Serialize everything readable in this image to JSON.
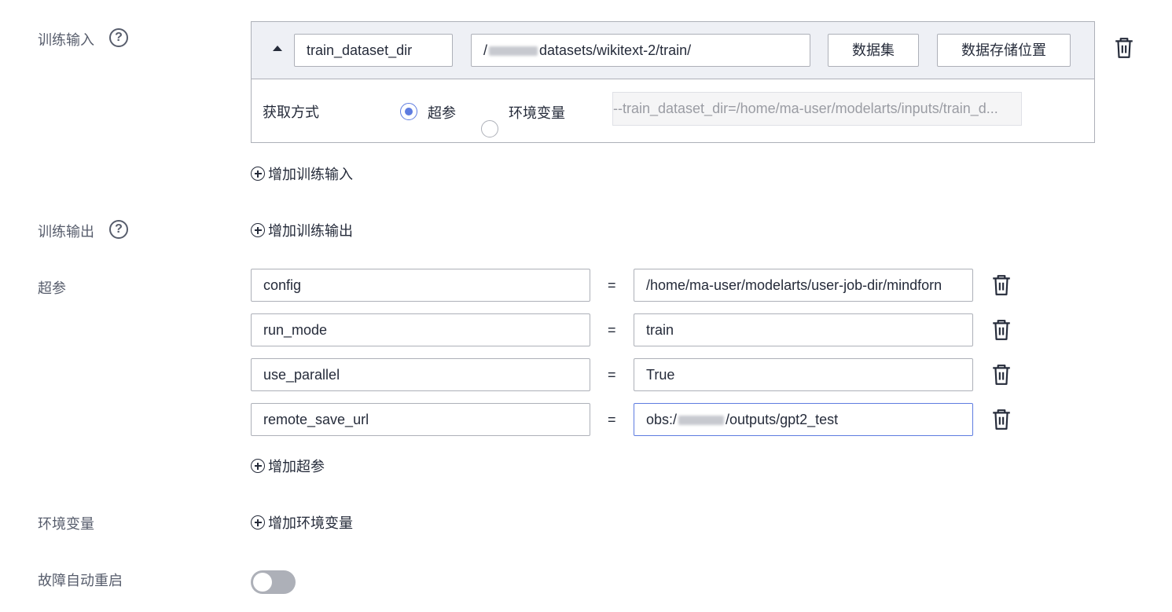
{
  "training_input": {
    "label": "训练输入",
    "help_icon": "question-circle-icon",
    "name_value": "train_dataset_dir",
    "path_prefix": "/",
    "path_suffix": "datasets/wikitext-2/train/",
    "dataset_button": "数据集",
    "storage_button": "数据存储位置",
    "acquire_label": "获取方式",
    "option_hyperparam": "超参",
    "option_env": "环境变量",
    "selected_option": "超参",
    "preview": "--train_dataset_dir=/home/ma-user/modelarts/inputs/train_d...",
    "add_label": "增加训练输入"
  },
  "training_output": {
    "label": "训练输出",
    "help_icon": "question-circle-icon",
    "add_label": "增加训练输出"
  },
  "hyperparams": {
    "label": "超参",
    "equals": "=",
    "rows": [
      {
        "key": "config",
        "value": "/home/ma-user/modelarts/user-job-dir/mindforn"
      },
      {
        "key": "run_mode",
        "value": "train"
      },
      {
        "key": "use_parallel",
        "value": "True"
      },
      {
        "key": "remote_save_url",
        "value_prefix": "obs:/",
        "value_suffix": "/outputs/gpt2_test"
      }
    ],
    "add_label": "增加超参"
  },
  "env_vars": {
    "label": "环境变量",
    "add_label": "增加环境变量"
  },
  "auto_restart": {
    "label": "故障自动重启",
    "enabled": false
  },
  "colors": {
    "accent": "#5e7ce0",
    "border": "#adb0b8",
    "header_bg": "#eef0f5",
    "toggle_off": "#adb0b8"
  }
}
